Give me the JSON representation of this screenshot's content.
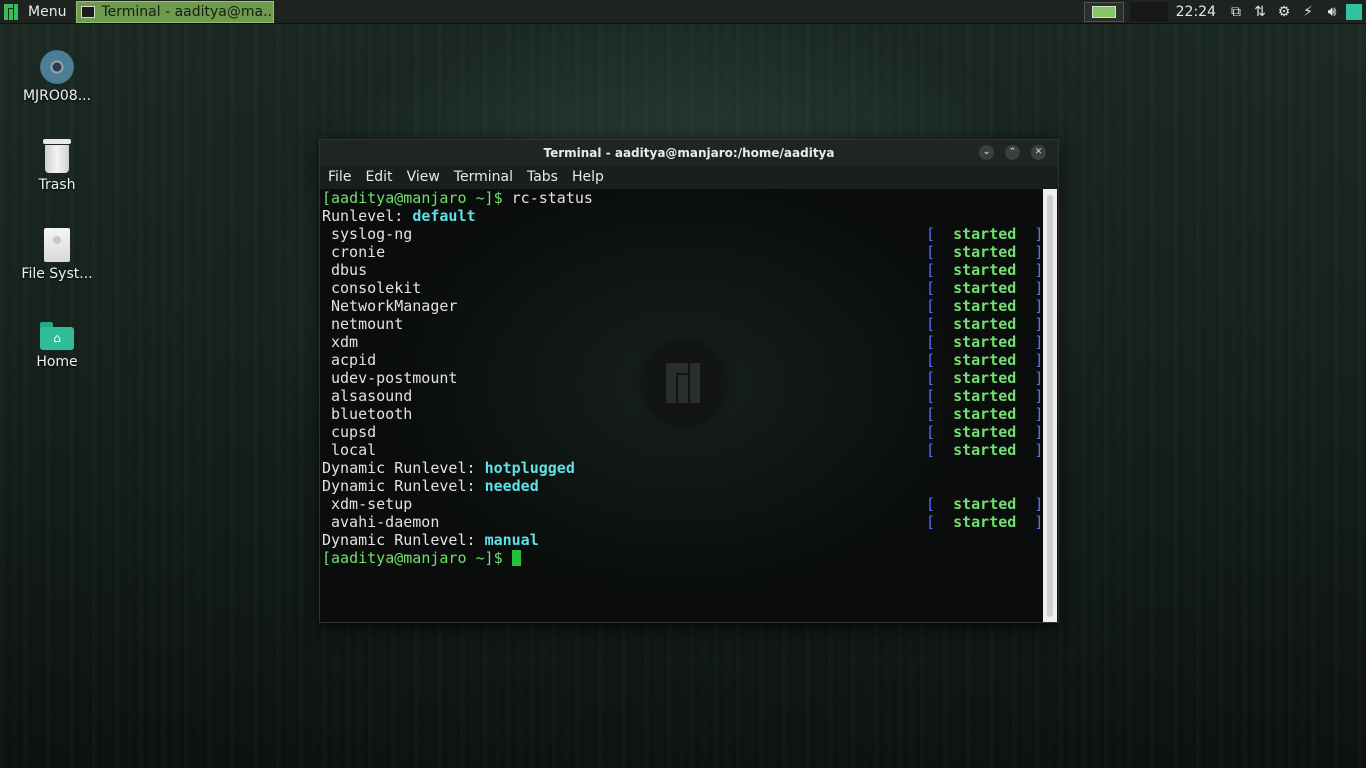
{
  "panel": {
    "menu_label": "Menu",
    "task_label": "Terminal - aaditya@ma...",
    "clock": "22:24",
    "tray_icons": [
      "clipboard-icon",
      "network-icon",
      "settings-icon",
      "power-icon",
      "volume-icon",
      "notification-icon"
    ]
  },
  "desktop": {
    "icons": [
      {
        "label": "MJRO08...",
        "icon": "disc-icon"
      },
      {
        "label": "Trash",
        "icon": "trash-icon"
      },
      {
        "label": "File Syst...",
        "icon": "drive-icon"
      },
      {
        "label": "Home",
        "icon": "home-folder-icon"
      }
    ]
  },
  "window": {
    "title": "Terminal - aaditya@manjaro:/home/aaditya",
    "menu": [
      "File",
      "Edit",
      "View",
      "Terminal",
      "Tabs",
      "Help"
    ]
  },
  "terminal": {
    "prompt": "[aaditya@manjaro ~]$",
    "command": "rc-status",
    "runlevel_prefix": "Runlevel:",
    "runlevel": "default",
    "dynamic_prefix": "Dynamic Runlevel:",
    "default_services": [
      "syslog-ng",
      "cronie",
      "dbus",
      "consolekit",
      "NetworkManager",
      "netmount",
      "xdm",
      "acpid",
      "udev-postmount",
      "alsasound",
      "bluetooth",
      "cupsd",
      "local"
    ],
    "dynamic_runlevels": [
      "hotplugged",
      "needed",
      "manual"
    ],
    "needed_services": [
      "xdm-setup",
      "avahi-daemon"
    ],
    "status_word": "started"
  },
  "colors": {
    "prompt": "#70e070",
    "runlevel": "#5ee2e8",
    "bracket": "#5a6cff",
    "status": "#70e070",
    "task_button": "#6e9a4e"
  }
}
